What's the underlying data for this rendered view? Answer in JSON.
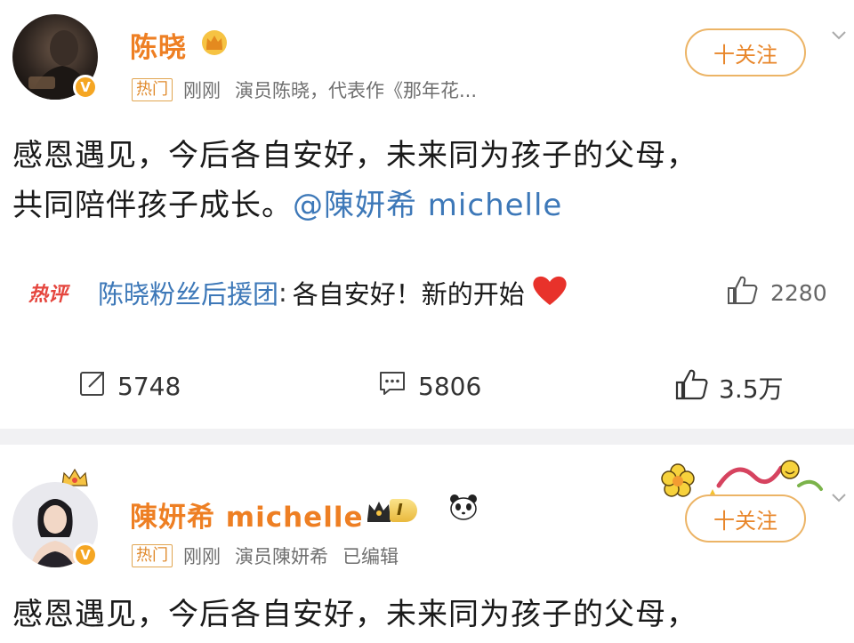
{
  "post1": {
    "author": "陈晓",
    "hot_tag": "热门",
    "time": "刚刚",
    "source": "演员陈晓，代表作《那年花...",
    "follow_label": "十关注",
    "text_line1": "感恩遇见，今后各自安好，未来同为孩子的父母，",
    "text_line2": "共同陪伴孩子成长。",
    "mention": "@陳妍希 michelle",
    "hot_comment": {
      "label": "热评",
      "author": "陈晓粉丝后援团",
      "colon": ":",
      "text": "各自安好！新的开始",
      "likes": "2280"
    },
    "actions": {
      "repost": "5748",
      "comment": "5806",
      "like": "3.5万"
    }
  },
  "post2": {
    "author": "陳妍希 michelle",
    "level": "I",
    "hot_tag": "热门",
    "time": "刚刚",
    "source": "演员陳妍希",
    "edited": "已编辑",
    "follow_label": "十关注",
    "text_line1": "感恩遇见，今后各自安好，未来同为孩子的父母，"
  },
  "colors": {
    "name": "#ee7f23",
    "mention": "#3d78b8",
    "hot_label": "#e5463e",
    "follow_border": "#ecb466",
    "divider": "#f1f1f3"
  },
  "icons": [
    "crown-icon",
    "verified-badge-icon",
    "chevron-down-icon",
    "thumbs-up-icon",
    "repost-icon",
    "comment-icon",
    "heart-icon",
    "panda-emoji-icon",
    "level-badge-icon",
    "decoration-flower-icon"
  ]
}
